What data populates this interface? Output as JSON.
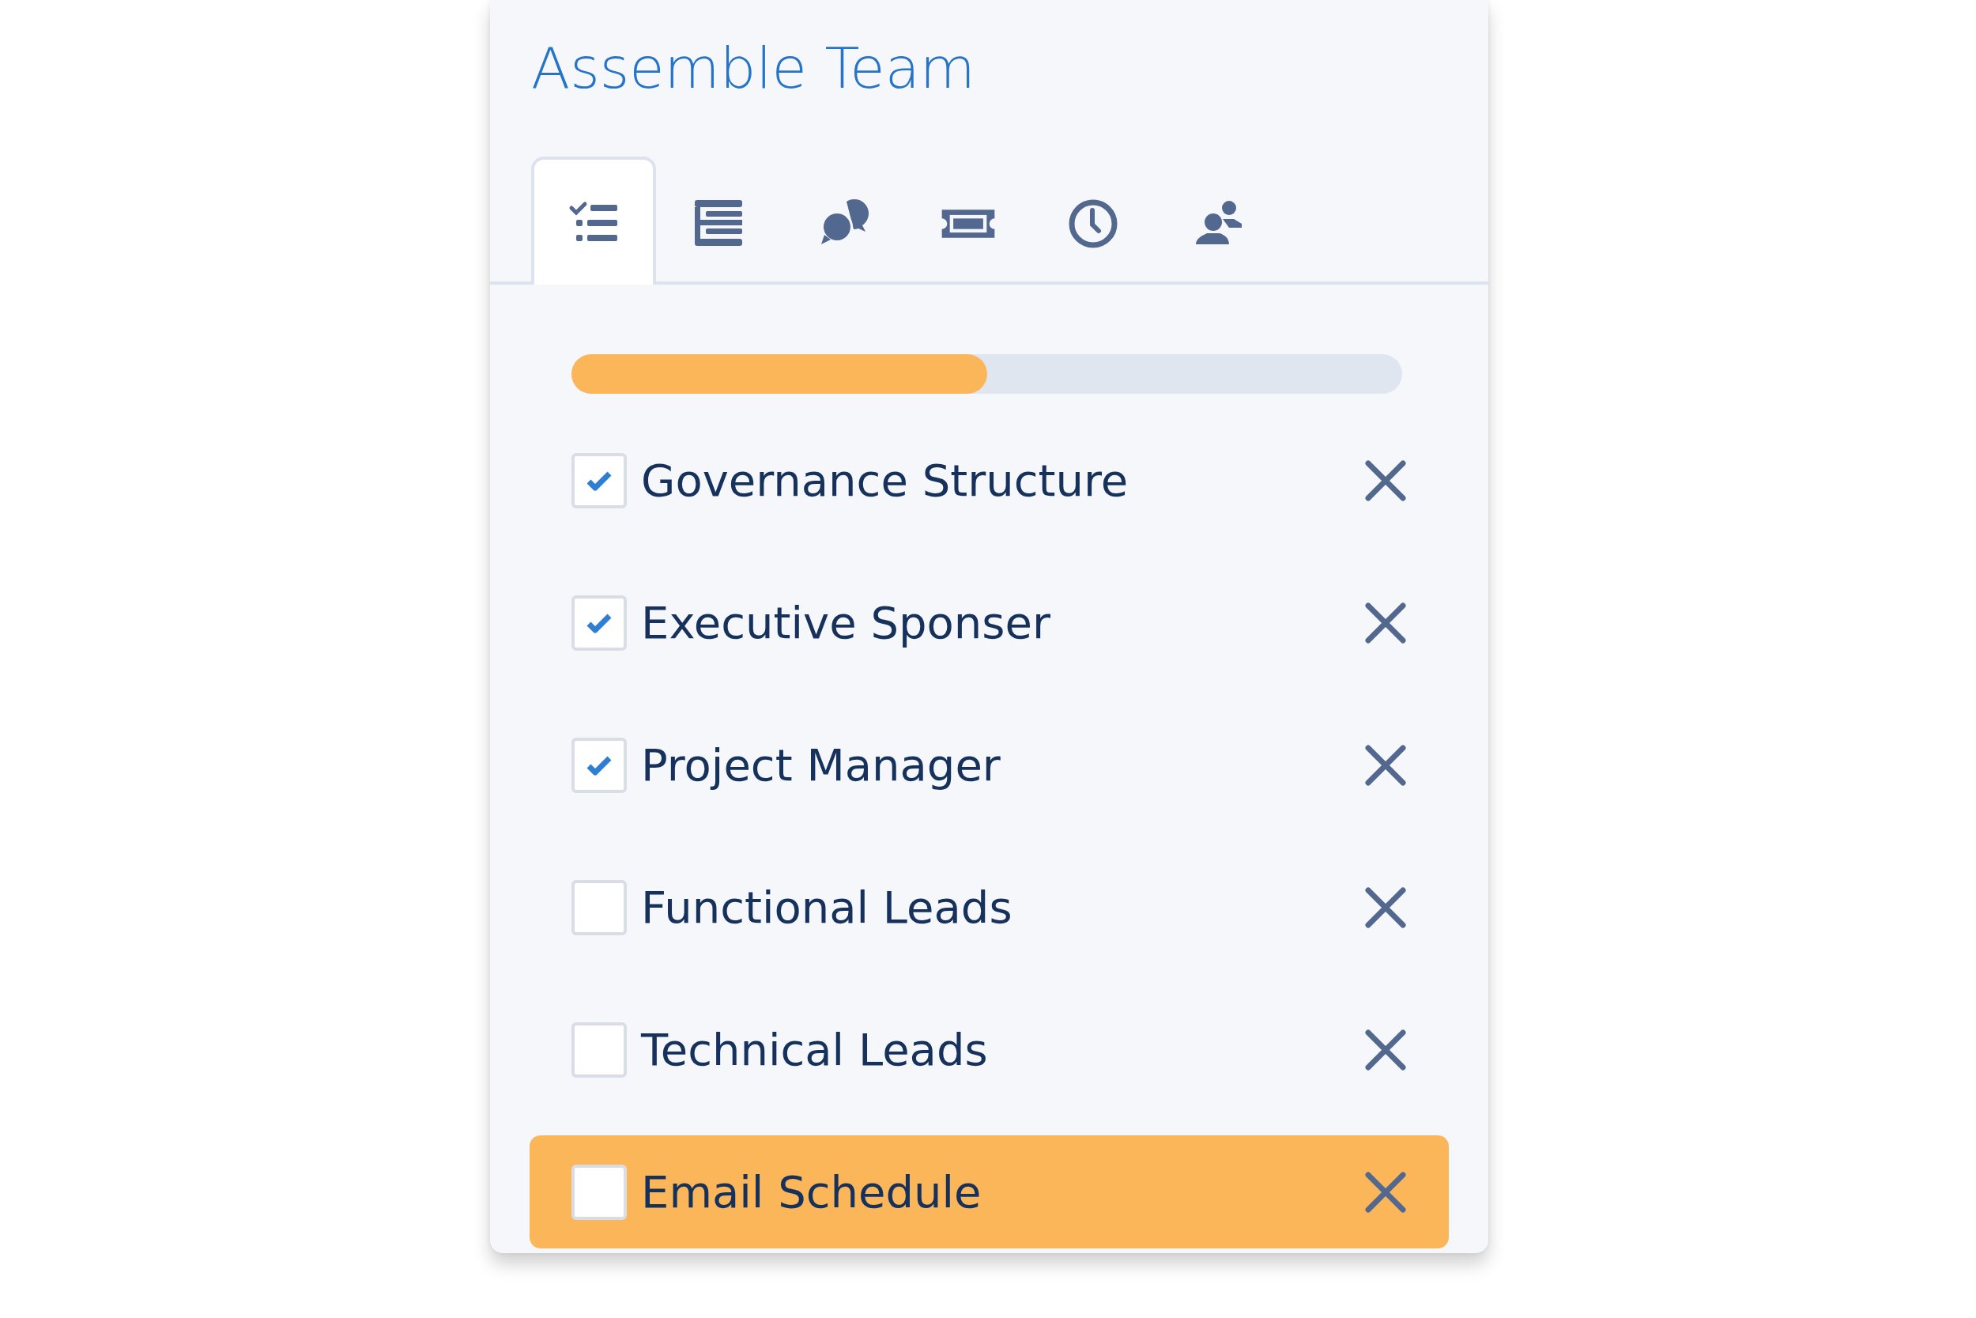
{
  "title": "Assemble Team",
  "tabs": [
    {
      "kind": "checklist",
      "selected": true
    },
    {
      "kind": "list",
      "selected": false
    },
    {
      "kind": "chat",
      "selected": false
    },
    {
      "kind": "ticket",
      "selected": false
    },
    {
      "kind": "clock",
      "selected": false
    },
    {
      "kind": "people",
      "selected": false
    }
  ],
  "progress": {
    "level": 0.5
  },
  "items": [
    {
      "label": "Governance Structure",
      "checked": true,
      "highlighted": false
    },
    {
      "label": "Executive Sponser",
      "checked": true,
      "highlighted": false
    },
    {
      "label": "Project Manager",
      "checked": true,
      "highlighted": false
    },
    {
      "label": "Functional Leads",
      "checked": false,
      "highlighted": false
    },
    {
      "label": "Technical Leads",
      "checked": false,
      "highlighted": false
    },
    {
      "label": "Email Schedule",
      "checked": false,
      "highlighted": true
    }
  ]
}
